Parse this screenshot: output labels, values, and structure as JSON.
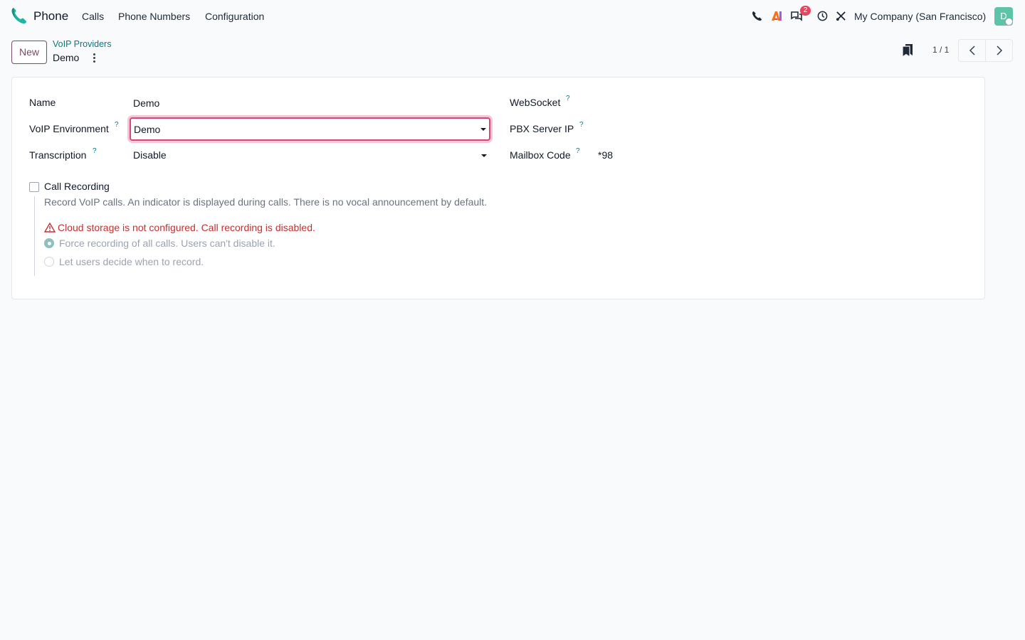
{
  "navbar": {
    "app_name": "Phone",
    "menu": [
      "Calls",
      "Phone Numbers",
      "Configuration"
    ],
    "icons": [
      "phone-icon",
      "ai-icon",
      "messages-icon",
      "clock-icon",
      "tools-icon"
    ],
    "message_count": "2",
    "company": "My Company (San Francisco)",
    "avatar_initial": "D"
  },
  "control_panel": {
    "new_label": "New",
    "breadcrumb": "VoIP Providers",
    "record_title": "Demo",
    "pager": "1 / 1"
  },
  "form": {
    "name_label": "Name",
    "name_value": "Demo",
    "environment_label": "VoIP Environment",
    "environment_value": "Demo",
    "transcription_label": "Transcription",
    "transcription_value": "Disable",
    "websocket_label": "WebSocket",
    "pbx_label": "PBX Server IP",
    "mailbox_label": "Mailbox Code",
    "mailbox_value": "*98",
    "help_mark": "?",
    "call_recording": {
      "label": "Call Recording",
      "checked": false,
      "description": "Record VoIP calls. An indicator is displayed during calls. There is no vocal announcement by default.",
      "warning": "Cloud storage is not configured. Call recording is disabled.",
      "options": [
        {
          "label": "Force recording of all calls. Users can't disable it.",
          "selected": true
        },
        {
          "label": "Let users decide when to record.",
          "selected": false
        }
      ]
    }
  },
  "colors": {
    "accent": "#017e84",
    "brand": "#7b4a6a",
    "focus": "#d8467c",
    "warning": "#c53030",
    "avatar": "#5cc4a9"
  }
}
